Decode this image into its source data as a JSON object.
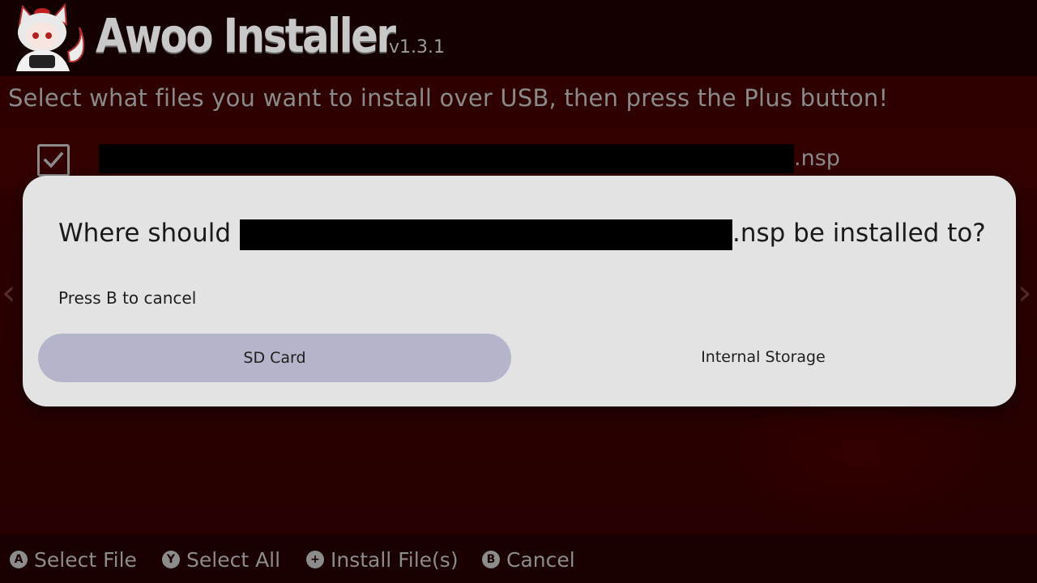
{
  "header": {
    "app_title": "Awoo Installer",
    "version": "v1.3.1",
    "logo_icon": "mascot-logo-icon"
  },
  "subtitle": "Select what files you want to install over USB, then press the Plus button!",
  "file_list": [
    {
      "checked": true,
      "name_suffix": ".nsp",
      "name_redacted": true
    }
  ],
  "dialog": {
    "question_prefix": "Where should",
    "question_suffix": ".nsp be installed to?",
    "hint": "Press B to cancel",
    "options": [
      {
        "label": "SD Card",
        "selected": true
      },
      {
        "label": "Internal Storage",
        "selected": false
      }
    ]
  },
  "footer": {
    "actions": [
      {
        "glyph": "A",
        "label": "Select File",
        "icon": "a-button-icon"
      },
      {
        "glyph": "Y",
        "label": "Select All",
        "icon": "y-button-icon"
      },
      {
        "glyph": "+",
        "label": "Install File(s)",
        "icon": "plus-button-icon"
      },
      {
        "glyph": "B",
        "label": "Cancel",
        "icon": "b-button-icon"
      }
    ]
  },
  "colors": {
    "background": "#2a0001",
    "header": "#140000",
    "dialog": "#e3e3e3",
    "selected_option": "#b4b5cb",
    "muted_text": "#8c8c8c"
  }
}
